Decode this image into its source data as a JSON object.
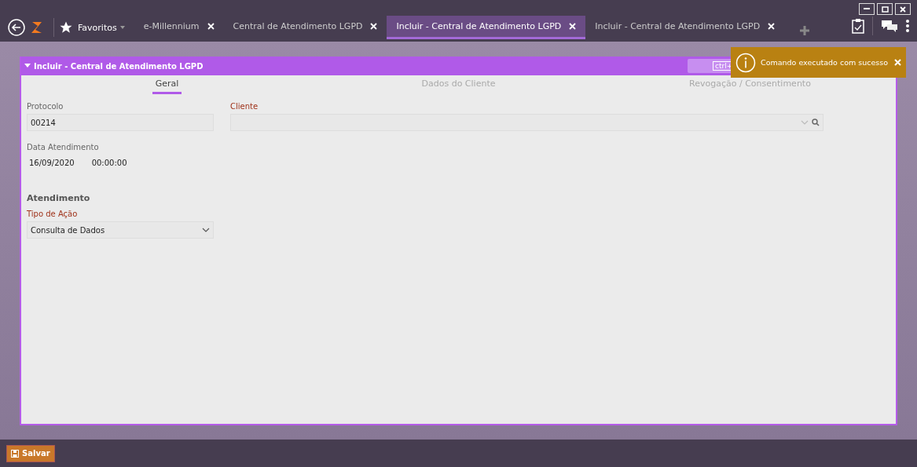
{
  "topbar": {
    "favorites": "Favoritos",
    "tabs": [
      {
        "label": "e-Millennium",
        "selected": false
      },
      {
        "label": "Central de Atendimento LGPD",
        "selected": false
      },
      {
        "label": "Incluir - Central de Atendimento LGPD",
        "selected": true
      },
      {
        "label": "Incluir - Central de Atendimento LGPD",
        "selected": false
      }
    ]
  },
  "panel": {
    "title": "Incluir - Central de Atendimento LGPD",
    "shortcut": "ctrl+",
    "tabs": [
      {
        "label": "Geral",
        "selected": true
      },
      {
        "label": "Dados do Cliente",
        "selected": false
      },
      {
        "label": "Revogação / Consentimento",
        "selected": false
      }
    ],
    "protocolo": {
      "label": "Protocolo",
      "value": "00214"
    },
    "data": {
      "label": "Data Atendimento",
      "date": "16/09/2020",
      "time": "00:00:00"
    },
    "cliente": {
      "label": "Cliente",
      "required": true
    },
    "section": "Atendimento",
    "tipo": {
      "label": "Tipo de Ação",
      "required": true,
      "value": "Consulta de Dados"
    }
  },
  "toast": {
    "message": "Comando executado com sucesso"
  },
  "save_button": "Salvar"
}
